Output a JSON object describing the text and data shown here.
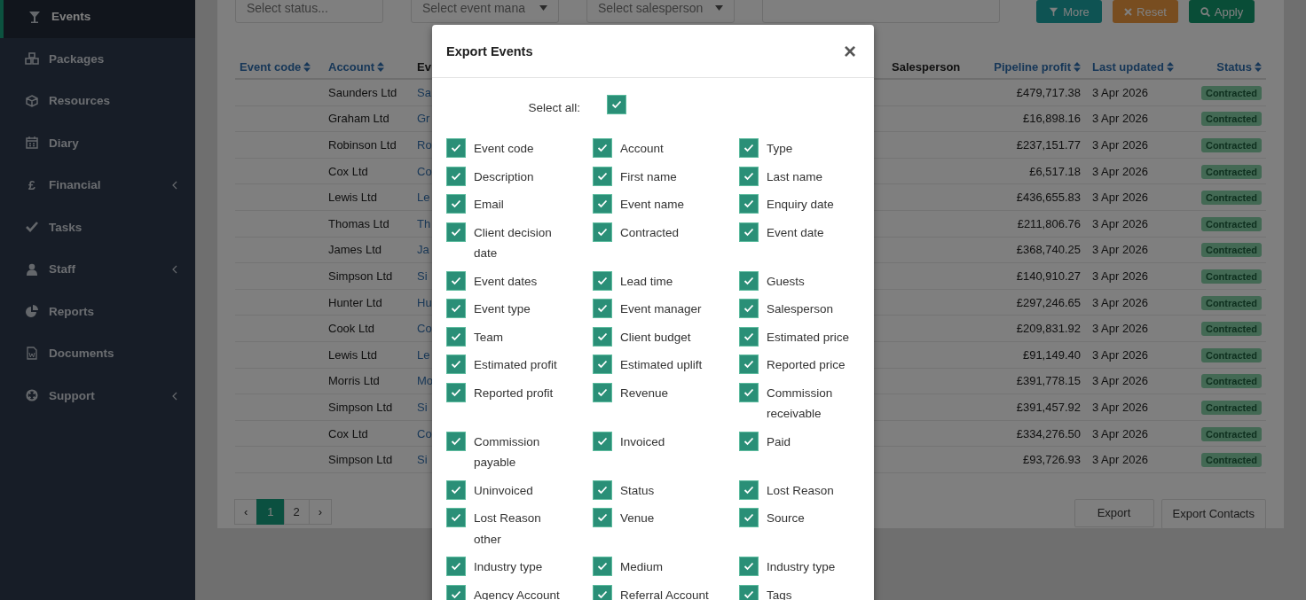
{
  "sidebar": {
    "items": [
      {
        "label": "Events",
        "selected": true,
        "has_submenu": false
      },
      {
        "label": "Packages",
        "selected": false,
        "has_submenu": false
      },
      {
        "label": "Resources",
        "selected": false,
        "has_submenu": false
      },
      {
        "label": "Diary",
        "selected": false,
        "has_submenu": false
      },
      {
        "label": "Financial",
        "icon_text": "£",
        "selected": false,
        "has_submenu": true
      },
      {
        "label": "Tasks",
        "selected": false,
        "has_submenu": false
      },
      {
        "label": "Staff",
        "selected": false,
        "has_submenu": true
      },
      {
        "label": "Reports",
        "selected": false,
        "has_submenu": false
      },
      {
        "label": "Documents",
        "selected": false,
        "has_submenu": false
      },
      {
        "label": "Support",
        "selected": false,
        "has_submenu": true
      }
    ]
  },
  "filters": {
    "fields": [
      {
        "kind": "select",
        "placeholder": "Select status...",
        "caret": false
      },
      {
        "kind": "select",
        "placeholder": "Select event mana",
        "caret": true
      },
      {
        "kind": "select",
        "placeholder": "Select salesperson",
        "caret": true
      },
      {
        "kind": "input"
      }
    ],
    "buttons": [
      {
        "label": "More",
        "kind": "more"
      },
      {
        "label": "Reset",
        "kind": "reset"
      },
      {
        "label": "Apply",
        "kind": "apply"
      }
    ]
  },
  "table": {
    "columns": [
      {
        "label": "Event code",
        "sortable": true
      },
      {
        "label": "Account",
        "sortable": true
      },
      {
        "label": "Ev",
        "sortable": false
      },
      {
        "label": "Salesperson",
        "sortable": false
      },
      {
        "label": "Pipeline profit",
        "sortable": true
      },
      {
        "label": "Last updated",
        "sortable": true
      },
      {
        "label": "Status",
        "sortable": true
      }
    ],
    "rows": [
      {
        "account": "Saunders Ltd",
        "column_3": "Sa",
        "pipeline_profit": "£479,717.38",
        "last_updated": "3 Apr 2026",
        "status": "Contracted"
      },
      {
        "account": "Graham Ltd",
        "column_3": "Gr",
        "pipeline_profit": "£16,898.16",
        "last_updated": "3 Apr 2026",
        "status": "Contracted"
      },
      {
        "account": "Robinson Ltd",
        "column_3": "Ro",
        "pipeline_profit": "£237,151.77",
        "last_updated": "3 Apr 2026",
        "status": "Contracted"
      },
      {
        "account": "Cox Ltd",
        "column_3": "Co",
        "pipeline_profit": "£6,517.18",
        "last_updated": "3 Apr 2026",
        "status": "Contracted"
      },
      {
        "account": "Lewis Ltd",
        "column_3": "Le",
        "pipeline_profit": "£436,655.83",
        "last_updated": "3 Apr 2026",
        "status": "Contracted"
      },
      {
        "account": "Thomas Ltd",
        "column_3": "Th",
        "pipeline_profit": "£211,806.76",
        "last_updated": "3 Apr 2026",
        "status": "Contracted"
      },
      {
        "account": "James Ltd",
        "column_3": "Ja",
        "pipeline_profit": "£368,740.25",
        "last_updated": "3 Apr 2026",
        "status": "Contracted"
      },
      {
        "account": "Simpson Ltd",
        "column_3": "Si",
        "pipeline_profit": "£140,910.27",
        "last_updated": "3 Apr 2026",
        "status": "Contracted"
      },
      {
        "account": "Hunter Ltd",
        "column_3": "Hu",
        "pipeline_profit": "£297,246.65",
        "last_updated": "3 Apr 2026",
        "status": "Contracted"
      },
      {
        "account": "Cook Ltd",
        "column_3": "Co",
        "pipeline_profit": "£209,831.92",
        "last_updated": "3 Apr 2026",
        "status": "Contracted"
      },
      {
        "account": "Lewis Ltd",
        "column_3": "Le",
        "pipeline_profit": "£91,149.40",
        "last_updated": "3 Apr 2026",
        "status": "Contracted"
      },
      {
        "account": "Morris Ltd",
        "column_3": "Mo",
        "pipeline_profit": "£391,778.15",
        "last_updated": "3 Apr 2026",
        "status": "Contracted"
      },
      {
        "account": "Simpson Ltd",
        "column_3": "Si",
        "pipeline_profit": "£391,457.92",
        "last_updated": "3 Apr 2026",
        "status": "Contracted"
      },
      {
        "account": "Cox Ltd",
        "column_3": "Co",
        "pipeline_profit": "£334,276.50",
        "last_updated": "3 Apr 2026",
        "status": "Contracted"
      },
      {
        "account": "Simpson Ltd",
        "column_3": "Si",
        "pipeline_profit": "£93,726.93",
        "last_updated": "3 Apr 2026",
        "status": "Contracted"
      }
    ]
  },
  "pagination": {
    "prev": "‹",
    "next": "›",
    "pages": [
      {
        "label": "1",
        "selected": true
      },
      {
        "label": "2",
        "selected": false
      }
    ]
  },
  "actions": [
    "Export",
    "Export Contacts"
  ],
  "modal": {
    "title": "Export Events",
    "close": "×",
    "select_all": {
      "label": "Select all:",
      "checked": true
    },
    "fields": [
      {
        "label": "Event code",
        "checked": true
      },
      {
        "label": "Account",
        "checked": true
      },
      {
        "label": "Type",
        "checked": true
      },
      {
        "label": "Description",
        "checked": true
      },
      {
        "label": "First name",
        "checked": true
      },
      {
        "label": "Last name",
        "checked": true
      },
      {
        "label": "Email",
        "checked": true
      },
      {
        "label": "Event name",
        "checked": true
      },
      {
        "label": "Enquiry date",
        "checked": true
      },
      {
        "label": "Client decision date",
        "checked": true
      },
      {
        "label": "Contracted",
        "checked": true
      },
      {
        "label": "Event date",
        "checked": true
      },
      {
        "label": "Event dates",
        "checked": true
      },
      {
        "label": "Lead time",
        "checked": true
      },
      {
        "label": "Guests",
        "checked": true
      },
      {
        "label": "Event type",
        "checked": true
      },
      {
        "label": "Event manager",
        "checked": true
      },
      {
        "label": "Salesperson",
        "checked": true
      },
      {
        "label": "Team",
        "checked": true
      },
      {
        "label": "Client budget",
        "checked": true
      },
      {
        "label": "Estimated price",
        "checked": true
      },
      {
        "label": "Estimated profit",
        "checked": true
      },
      {
        "label": "Estimated uplift",
        "checked": true
      },
      {
        "label": "Reported price",
        "checked": true
      },
      {
        "label": "Reported profit",
        "checked": true
      },
      {
        "label": "Revenue",
        "checked": true
      },
      {
        "label": "Commission receivable",
        "checked": true
      },
      {
        "label": "Commission payable",
        "checked": true
      },
      {
        "label": "Invoiced",
        "checked": true
      },
      {
        "label": "Paid",
        "checked": true
      },
      {
        "label": "Uninvoiced",
        "checked": true
      },
      {
        "label": "Status",
        "checked": true
      },
      {
        "label": "Lost Reason",
        "checked": true
      },
      {
        "label": "Lost Reason other",
        "checked": true
      },
      {
        "label": "Venue",
        "checked": true
      },
      {
        "label": "Source",
        "checked": true
      },
      {
        "label": "Industry type",
        "checked": true
      },
      {
        "label": "Medium",
        "checked": true
      },
      {
        "label": "Industry type",
        "checked": true
      },
      {
        "label": "Agency Account",
        "checked": true
      },
      {
        "label": "Referral Account",
        "checked": true
      },
      {
        "label": "Tags",
        "checked": true
      }
    ]
  }
}
